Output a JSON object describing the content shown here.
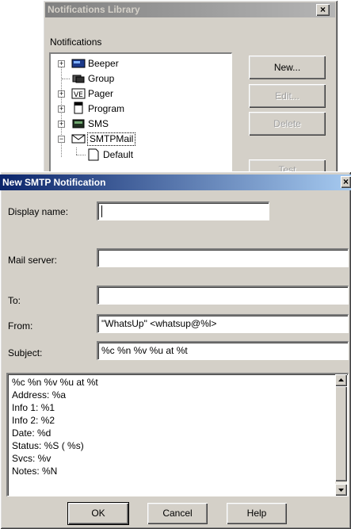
{
  "library": {
    "title": "Notifications Library",
    "close": "×",
    "group_label": "Notifications",
    "tree": [
      {
        "label": "Beeper",
        "icon": "beeper-icon",
        "expander": "+"
      },
      {
        "label": "Group",
        "icon": "group-icon",
        "expander": ""
      },
      {
        "label": "Pager",
        "icon": "pager-icon",
        "expander": "+"
      },
      {
        "label": "Program",
        "icon": "program-icon",
        "expander": "+"
      },
      {
        "label": "SMS",
        "icon": "sms-icon",
        "expander": "+"
      },
      {
        "label": "SMTPMail",
        "icon": "mail-icon",
        "expander": "−"
      },
      {
        "label": "Default",
        "icon": "document-icon",
        "expander": ""
      }
    ],
    "buttons": {
      "new": "New...",
      "edit": "Edit...",
      "delete": "Delete",
      "test": "Test"
    }
  },
  "smtp": {
    "title": "New SMTP Notification",
    "close": "×",
    "display_name_label": "Display name:",
    "display_name_value": "",
    "mail_server_label": "Mail server:",
    "mail_server_value": "",
    "to_label": "To:",
    "to_value": "",
    "from_label": "From:",
    "from_value": "\"WhatsUp\" <whatsup@%l>",
    "subject_label": "Subject:",
    "subject_value": "%c %n %v %u at %t",
    "body_lines": [
      "%c %n %v %u at %t",
      "Address: %a",
      "Info 1: %1",
      "Info 2: %2",
      "Date: %d",
      "Status: %S ( %s)",
      "Svcs: %v",
      "Notes: %N"
    ],
    "ok_label": "OK",
    "cancel_label": "Cancel",
    "help_label": "Help"
  },
  "colors": {
    "dialog_bg": "#d4d0c8",
    "active_title": "#0a246a",
    "inactive_title": "#808080"
  }
}
